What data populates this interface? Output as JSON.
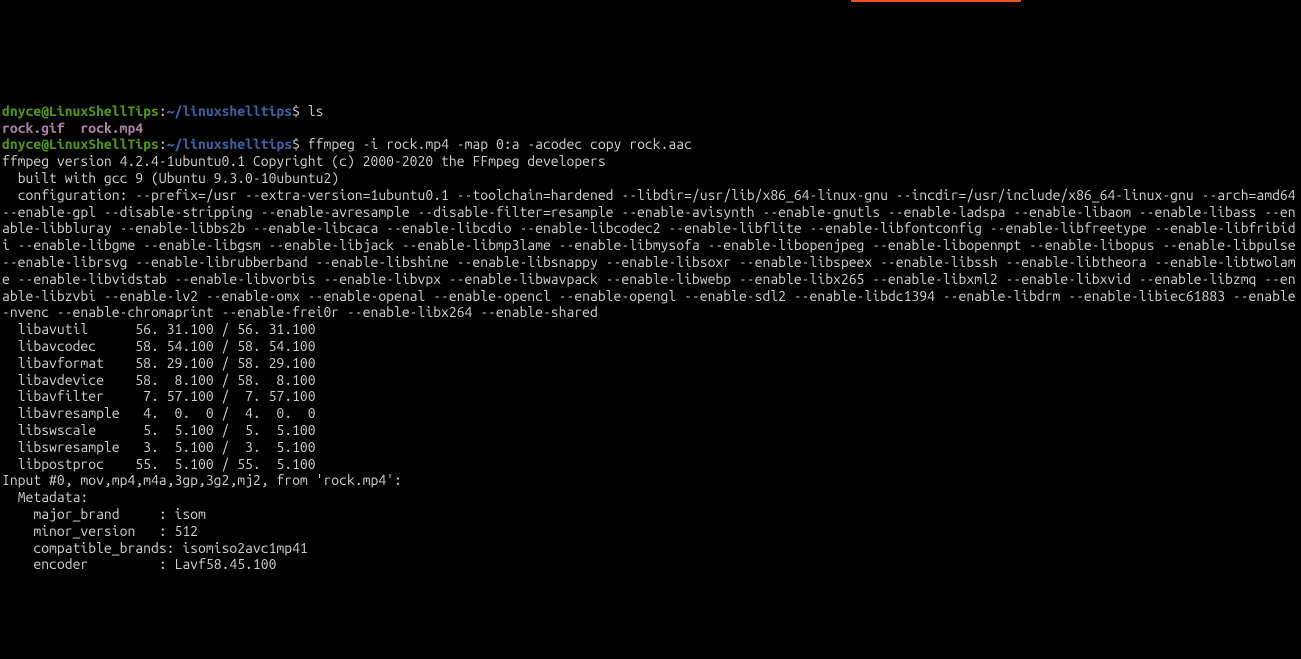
{
  "prompt1": {
    "user": "dnyce@LinuxShellTips",
    "colon": ":",
    "path": "~/linuxshelltips",
    "dollar": "$ ",
    "cmd": "ls"
  },
  "ls_output": {
    "file1": "rock.gif",
    "sep": "  ",
    "file2": "rock.mp4"
  },
  "prompt2": {
    "user": "dnyce@LinuxShellTips",
    "colon": ":",
    "path": "~/linuxshelltips",
    "dollar": "$ ",
    "cmd": "ffmpeg -i rock.mp4 -map 0:a -acodec copy rock.aac"
  },
  "out": {
    "l1": "ffmpeg version 4.2.4-1ubuntu0.1 Copyright (c) 2000-2020 the FFmpeg developers",
    "l2": "  built with gcc 9 (Ubuntu 9.3.0-10ubuntu2)",
    "l3": "  configuration: --prefix=/usr --extra-version=1ubuntu0.1 --toolchain=hardened --libdir=/usr/lib/x86_64-linux-gnu --incdir=/usr/include/x86_64-linux-gnu --arch=amd64 --enable-gpl --disable-stripping --enable-avresample --disable-filter=resample --enable-avisynth --enable-gnutls --enable-ladspa --enable-libaom --enable-libass --enable-libbluray --enable-libbs2b --enable-libcaca --enable-libcdio --enable-libcodec2 --enable-libflite --enable-libfontconfig --enable-libfreetype --enable-libfribidi --enable-libgme --enable-libgsm --enable-libjack --enable-libmp3lame --enable-libmysofa --enable-libopenjpeg --enable-libopenmpt --enable-libopus --enable-libpulse --enable-librsvg --enable-librubberband --enable-libshine --enable-libsnappy --enable-libsoxr --enable-libspeex --enable-libssh --enable-libtheora --enable-libtwolame --enable-libvidstab --enable-libvorbis --enable-libvpx --enable-libwavpack --enable-libwebp --enable-libx265 --enable-libxml2 --enable-libxvid --enable-libzmq --enable-libzvbi --enable-lv2 --enable-omx --enable-openal --enable-opencl --enable-opengl --enable-sdl2 --enable-libdc1394 --enable-libdrm --enable-libiec61883 --enable-nvenc --enable-chromaprint --enable-frei0r --enable-libx264 --enable-shared",
    "l4": "  libavutil      56. 31.100 / 56. 31.100",
    "l5": "  libavcodec     58. 54.100 / 58. 54.100",
    "l6": "  libavformat    58. 29.100 / 58. 29.100",
    "l7": "  libavdevice    58.  8.100 / 58.  8.100",
    "l8": "  libavfilter     7. 57.100 /  7. 57.100",
    "l9": "  libavresample   4.  0.  0 /  4.  0.  0",
    "l10": "  libswscale      5.  5.100 /  5.  5.100",
    "l11": "  libswresample   3.  5.100 /  3.  5.100",
    "l12": "  libpostproc    55.  5.100 / 55.  5.100",
    "l13": "Input #0, mov,mp4,m4a,3gp,3g2,mj2, from 'rock.mp4':",
    "l14": "  Metadata:",
    "l15": "    major_brand     : isom",
    "l16": "    minor_version   : 512",
    "l17": "    compatible_brands: isomiso2avc1mp41",
    "l18": "    encoder         : Lavf58.45.100"
  }
}
